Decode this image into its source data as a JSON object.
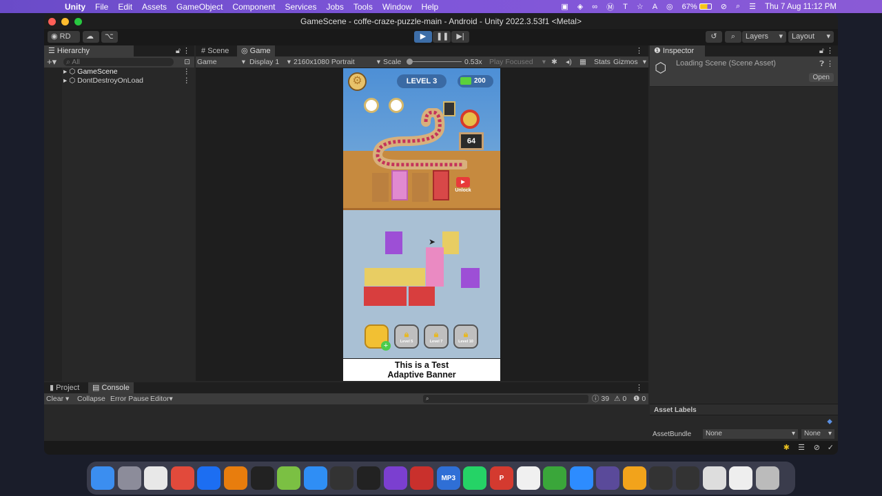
{
  "menubar": {
    "items": [
      "Unity",
      "File",
      "Edit",
      "Assets",
      "GameObject",
      "Component",
      "Services",
      "Jobs",
      "Tools",
      "Window",
      "Help"
    ],
    "battery": "67%",
    "datetime": "Thu 7 Aug  11:12 PM"
  },
  "window": {
    "title": "GameScene - coffe-craze-puzzle-main - Android - Unity 2022.3.53f1 <Metal>"
  },
  "toolbar": {
    "account": "RD",
    "layers": "Layers",
    "layout": "Layout"
  },
  "hierarchy": {
    "tab": "Hierarchy",
    "search_placeholder": "All",
    "items": [
      "GameScene",
      "DontDestroyOnLoad"
    ]
  },
  "gameview": {
    "tabs": [
      "Scene",
      "Game"
    ],
    "mode": "Game",
    "display": "Display 1",
    "resolution": "2160x1080 Portrait",
    "scale_label": "Scale",
    "scale": "0.53x",
    "play_focused": "Play Focused",
    "stats": "Stats",
    "gizmos": "Gizmos"
  },
  "game": {
    "level": "LEVEL 3",
    "money": "200",
    "counter": "64",
    "unlock": "Unlock",
    "level_buttons": [
      "Level 5",
      "Level 7",
      "Level 10"
    ],
    "banner": [
      "This is a Test",
      "Adaptive Banner"
    ]
  },
  "inspector": {
    "tab": "Inspector",
    "title": "Loading Scene (Scene Asset)",
    "open": "Open",
    "asset_labels": "Asset Labels",
    "asset_bundle": "AssetBundle",
    "bundle_value": "None",
    "variant_value": "None"
  },
  "console": {
    "tabs": [
      "Project",
      "Console"
    ],
    "clear": "Clear",
    "collapse": "Collapse",
    "error_pause": "Error Pause",
    "editor": "Editor",
    "log_count": "39",
    "warn_count": "0",
    "error_count": "0"
  },
  "dock": {
    "apps": [
      {
        "name": "finder",
        "color": "#3b8ef0"
      },
      {
        "name": "launchpad",
        "color": "#8c8c9a"
      },
      {
        "name": "chrome",
        "color": "#e8e8e8"
      },
      {
        "name": "git",
        "color": "#e24a3b"
      },
      {
        "name": "app-a",
        "color": "#1c6ef2"
      },
      {
        "name": "blender",
        "color": "#e87d0d"
      },
      {
        "name": "activity-monitor",
        "color": "#222"
      },
      {
        "name": "android-studio",
        "color": "#7bc043"
      },
      {
        "name": "safari",
        "color": "#2f8ef5"
      },
      {
        "name": "unity-hub",
        "color": "#333"
      },
      {
        "name": "unity",
        "color": "#222"
      },
      {
        "name": "visual-studio",
        "color": "#7b3fd0"
      },
      {
        "name": "filezilla",
        "color": "#c9302c"
      },
      {
        "name": "mp3",
        "color": "#2f6fd6",
        "label": "MP3"
      },
      {
        "name": "whatsapp",
        "color": "#25d366"
      },
      {
        "name": "app-p",
        "color": "#d43a2f",
        "label": "P"
      },
      {
        "name": "app-wave",
        "color": "#f0f0f0"
      },
      {
        "name": "app-c",
        "color": "#3aa63a"
      },
      {
        "name": "zoom",
        "color": "#2d8cff"
      },
      {
        "name": "app-circle",
        "color": "#5a4a9a"
      },
      {
        "name": "app-store",
        "color": "#f2a31b"
      },
      {
        "name": "unity-2",
        "color": "#333"
      },
      {
        "name": "unity-3",
        "color": "#333"
      },
      {
        "name": "chrome-2",
        "color": "#ddd"
      },
      {
        "name": "document",
        "color": "#eee"
      },
      {
        "name": "trash",
        "color": "#bbb"
      }
    ]
  }
}
